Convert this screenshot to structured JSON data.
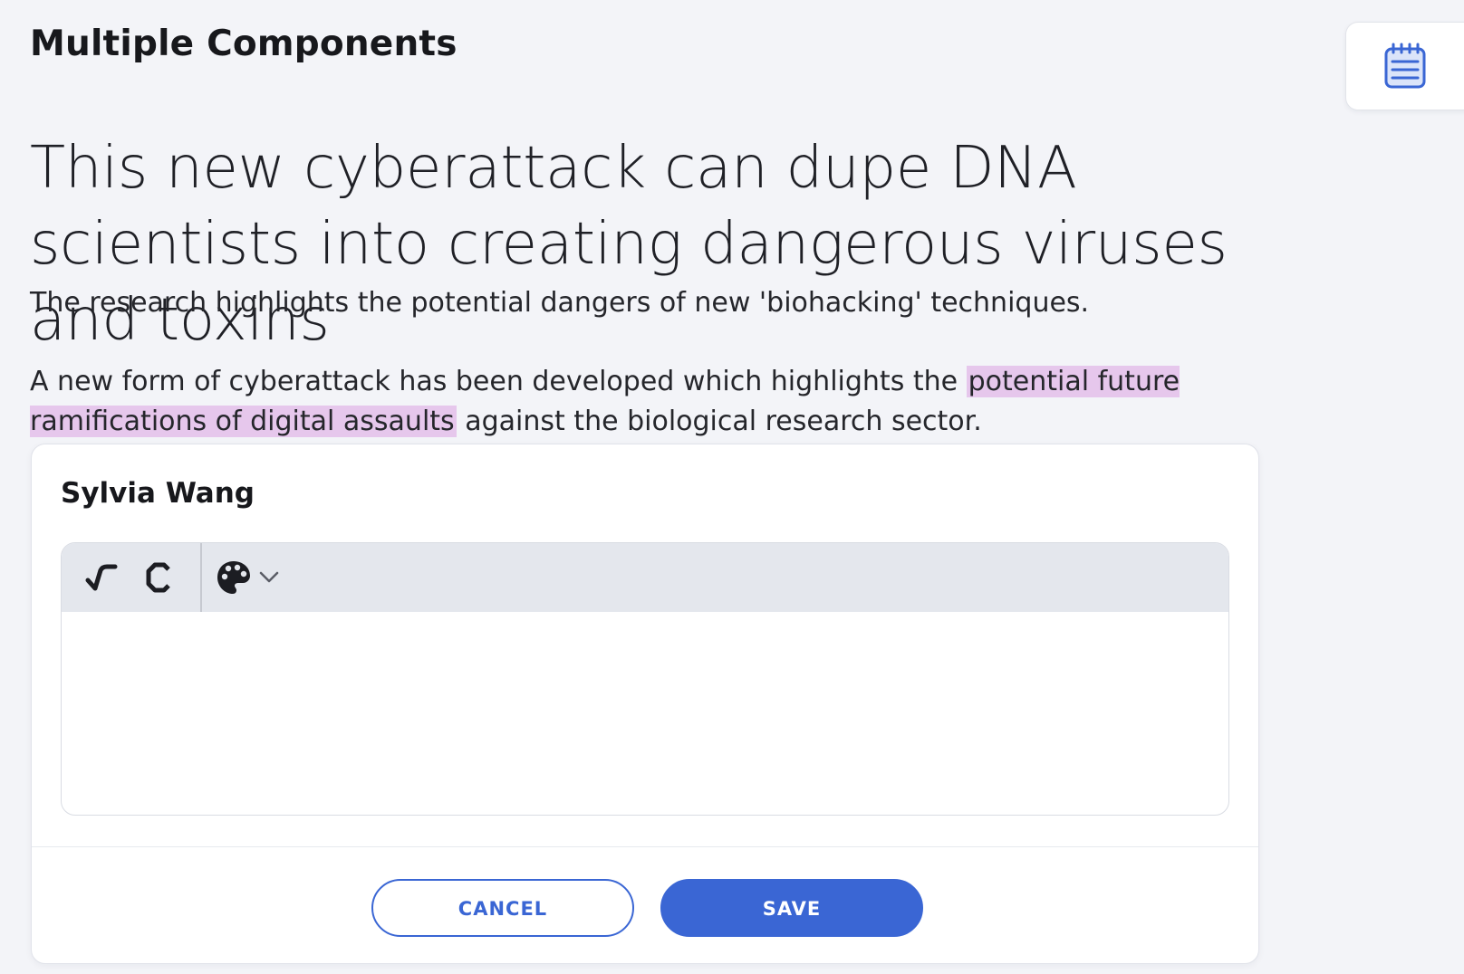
{
  "page": {
    "heading": "Multiple Components"
  },
  "notes_button": {
    "icon": "notepad-icon",
    "color": "#3a66d4"
  },
  "article": {
    "title": "This new cyberattack can dupe DNA scientists into creating dangerous viruses and toxins",
    "subtitle": "The research highlights the potential dangers of new 'biohacking' techniques.",
    "body_before": "A new form of cyberattack has been developed which highlights the ",
    "body_highlight": "potential future ramifications of digital assaults",
    "body_after": " against the biological research sector.",
    "highlight_color": "#e6c7ec"
  },
  "comment": {
    "author": "Sylvia Wang",
    "toolbar": {
      "tools": [
        "check-icon",
        "c-icon",
        "palette-icon",
        "chevron-down-icon"
      ]
    },
    "editor_value": "",
    "cancel_label": "CANCEL",
    "save_label": "SAVE",
    "accent_color": "#3a66d4"
  }
}
